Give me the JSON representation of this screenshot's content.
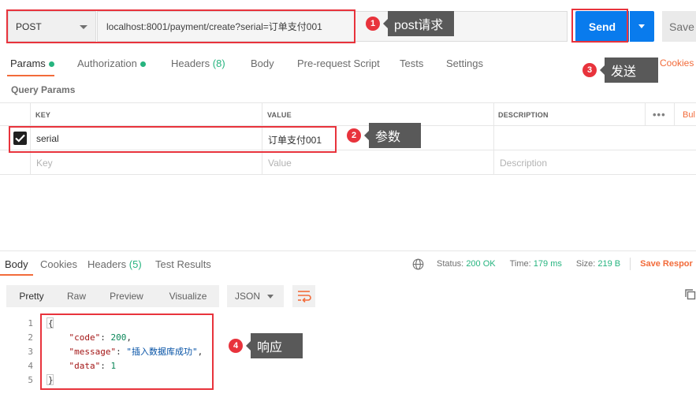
{
  "request": {
    "method": "POST",
    "url": "localhost:8001/payment/create?serial=订单支付001",
    "send_label": "Send",
    "save_label": "Save"
  },
  "request_tabs": {
    "params": "Params",
    "authorization": "Authorization",
    "headers": "Headers",
    "headers_count": "(8)",
    "body": "Body",
    "prerequest": "Pre-request Script",
    "tests": "Tests",
    "settings": "Settings",
    "cookies": "Cookies"
  },
  "query_params": {
    "title": "Query Params",
    "columns": {
      "key": "KEY",
      "value": "VALUE",
      "description": "DESCRIPTION",
      "more": "•••",
      "bulk": "Bul"
    },
    "rows": [
      {
        "key": "serial",
        "value": "订单支付001",
        "description": "",
        "checked": true
      }
    ],
    "placeholder": {
      "key": "Key",
      "value": "Value",
      "description": "Description"
    }
  },
  "response_tabs": {
    "body": "Body",
    "cookies": "Cookies",
    "headers": "Headers",
    "headers_count": "(5)",
    "test_results": "Test Results"
  },
  "response_status": {
    "status_label": "Status:",
    "status_value": "200 OK",
    "time_label": "Time:",
    "time_value": "179 ms",
    "size_label": "Size:",
    "size_value": "219 B",
    "save_response": "Save Respor"
  },
  "response_toolbar": {
    "formats": [
      "Pretty",
      "Raw",
      "Preview",
      "Visualize"
    ],
    "active_format": "Pretty",
    "language": "JSON"
  },
  "response_body": {
    "line_numbers": [
      "1",
      "2",
      "3",
      "4",
      "5"
    ],
    "open_brace": "{",
    "close_brace": "}",
    "code_key": "\"code\"",
    "code_value": "200",
    "message_key": "\"message\"",
    "message_value": "\"插入数据库成功\"",
    "data_key": "\"data\"",
    "data_value": "1"
  },
  "annotations": [
    {
      "number": "1",
      "label": "post请求"
    },
    {
      "number": "2",
      "label": "参数"
    },
    {
      "number": "3",
      "label": "发送"
    },
    {
      "number": "4",
      "label": "响应"
    }
  ],
  "colors": {
    "accent": "#f26b3a",
    "send_blue": "#097bed",
    "success_green": "#26b47f",
    "annotation_red": "#e8333c",
    "callout_gray": "#595959"
  }
}
